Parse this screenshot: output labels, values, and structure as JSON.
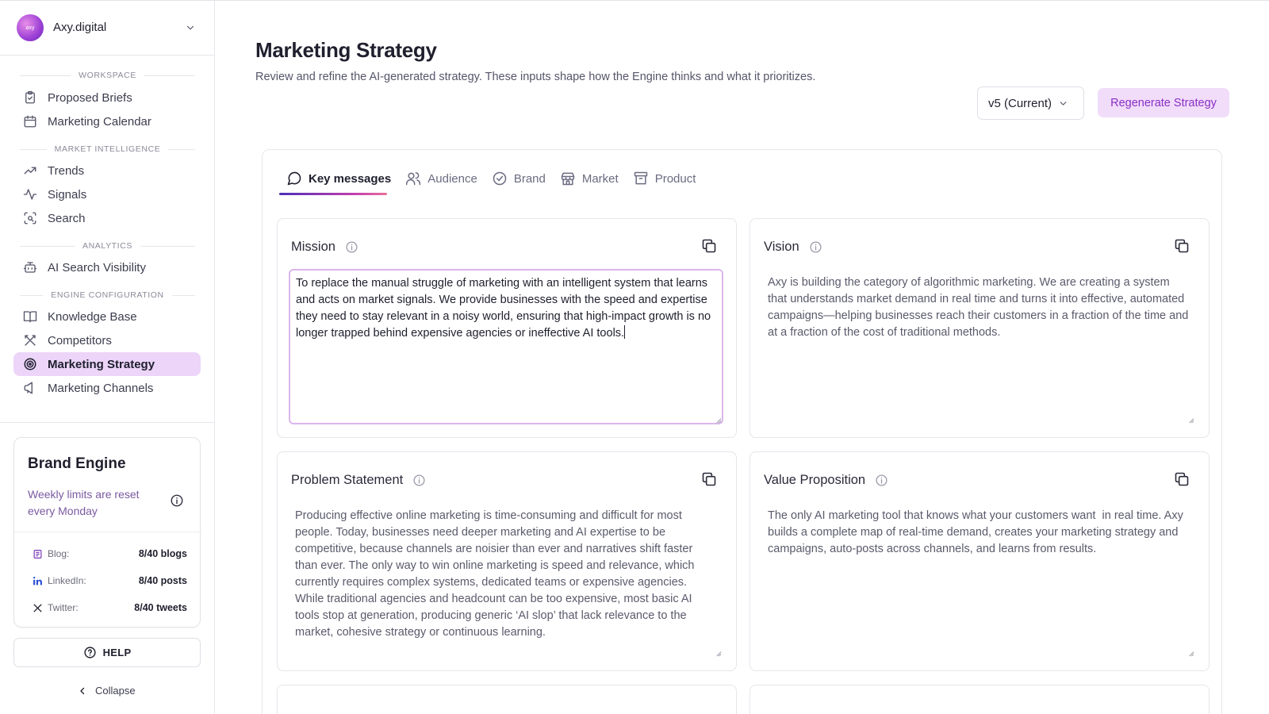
{
  "org": {
    "name": "Axy.digital",
    "avatar_text": "axy"
  },
  "sidebar": {
    "sections": [
      {
        "label": "WORKSPACE"
      },
      {
        "label": "MARKET INTELLIGENCE"
      },
      {
        "label": "ANALYTICS"
      },
      {
        "label": "ENGINE CONFIGURATION"
      }
    ],
    "items": [
      {
        "label": "Proposed Briefs",
        "icon": "clipboard-icon"
      },
      {
        "label": "Marketing Calendar",
        "icon": "calendar-icon"
      },
      {
        "label": "Trends",
        "icon": "trending-up-icon"
      },
      {
        "label": "Signals",
        "icon": "activity-icon"
      },
      {
        "label": "Search",
        "icon": "scan-search-icon"
      },
      {
        "label": "AI Search Visibility",
        "icon": "bot-icon"
      },
      {
        "label": "Knowledge Base",
        "icon": "book-icon"
      },
      {
        "label": "Competitors",
        "icon": "swords-icon"
      },
      {
        "label": "Marketing Strategy",
        "icon": "target-icon",
        "active": true
      },
      {
        "label": "Marketing Channels",
        "icon": "megaphone-icon"
      }
    ]
  },
  "brand_engine": {
    "title": "Brand Engine",
    "subtitle": "Weekly limits are reset every Monday",
    "limits": [
      {
        "label": "Blog:",
        "value": "8/40 blogs",
        "icon": "blog-icon"
      },
      {
        "label": "LinkedIn:",
        "value": "8/40 posts",
        "icon": "linkedin-icon"
      },
      {
        "label": "Twitter:",
        "value": "8/40 tweets",
        "icon": "x-icon"
      }
    ]
  },
  "help": {
    "label": "HELP"
  },
  "collapse": {
    "label": "Collapse"
  },
  "page": {
    "title": "Marketing Strategy",
    "subtitle": "Review and refine the AI-generated strategy. These inputs shape how the Engine thinks and what it prioritizes.",
    "version": "v5 (Current)",
    "regenerate_label": "Regenerate Strategy"
  },
  "tabs": [
    {
      "label": "Key messages",
      "icon": "message-circle-icon",
      "active": true
    },
    {
      "label": "Audience",
      "icon": "users-icon"
    },
    {
      "label": "Brand",
      "icon": "badge-check-icon"
    },
    {
      "label": "Market",
      "icon": "store-icon"
    },
    {
      "label": "Product",
      "icon": "archive-icon"
    }
  ],
  "cards": {
    "mission": {
      "title": "Mission",
      "text": "To replace the manual struggle of marketing with an intelligent system that learns and acts on market signals. We provide businesses with the speed and expertise they need to stay relevant in a noisy world, ensuring that high-impact growth is no longer trapped behind expensive agencies or ineffective AI tools."
    },
    "vision": {
      "title": "Vision",
      "text": "Axy is building the category of algorithmic marketing. We are creating a system that understands market demand in real time and turns it into effective, automated campaigns—helping businesses reach their customers in a fraction of the time and at a fraction of the cost of traditional methods."
    },
    "problem": {
      "title": "Problem Statement",
      "text": "Producing effective online marketing is time-consuming and difficult for most people. Today, businesses need deeper marketing and AI expertise to be competitive, because channels are noisier than ever and narratives shift faster than ever. The only way to win online marketing is speed and relevance, which currently requires complex systems, dedicated teams or expensive agencies. While traditional agencies and headcount can be too expensive, most basic AI tools stop at generation, producing generic ‘AI slop’ that lack relevance to the market, cohesive strategy or continuous learning."
    },
    "value": {
      "title": "Value Proposition",
      "text": "The only AI marketing tool that knows what your customers want  in real time. Axy builds a complete map of real-time demand, creates your marketing strategy and campaigns, auto-posts across channels, and learns from results."
    }
  }
}
